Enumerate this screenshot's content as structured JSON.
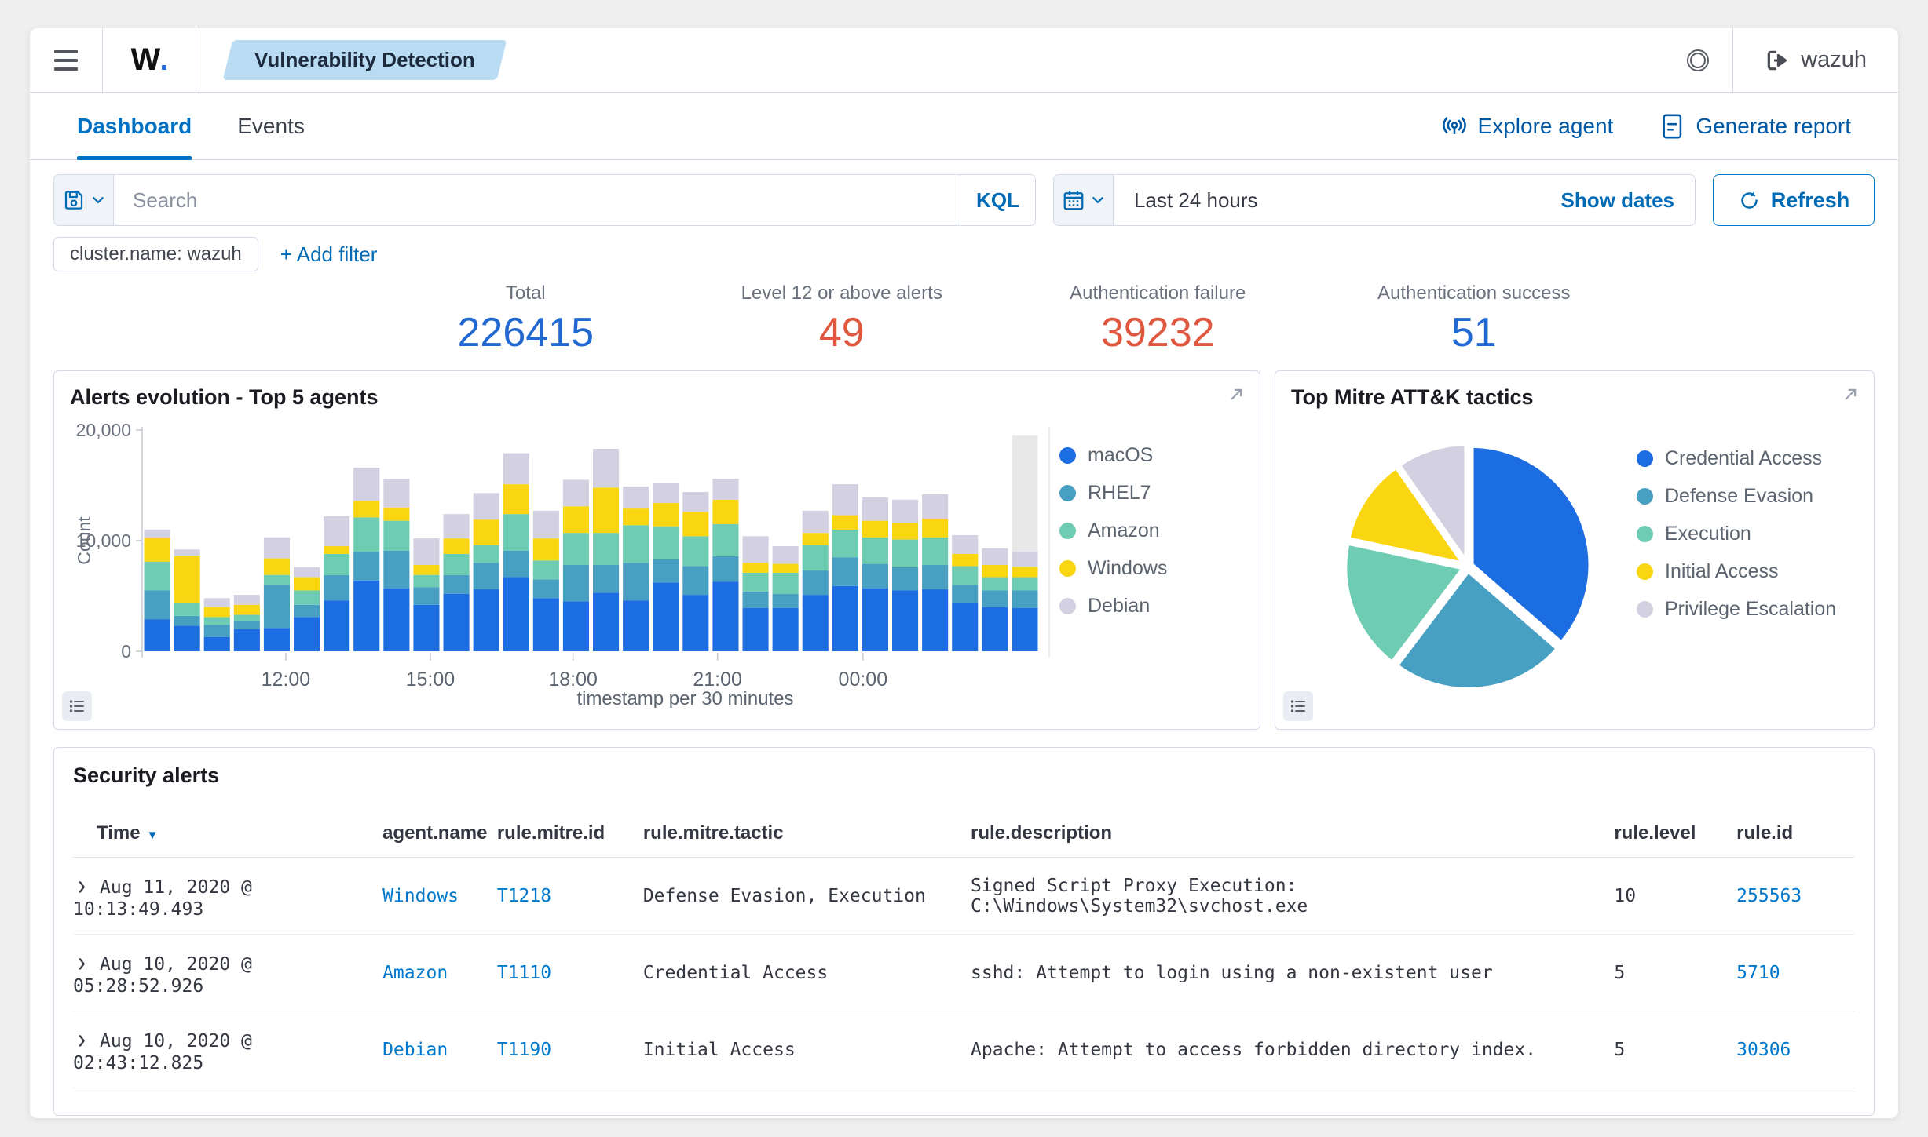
{
  "header": {
    "logo_text": "W",
    "logo_dot": ".",
    "breadcrumb": "Vulnerability Detection",
    "user": "wazuh"
  },
  "tabs": {
    "items": [
      {
        "label": "Dashboard"
      },
      {
        "label": "Events"
      }
    ],
    "actions": [
      {
        "label": "Explore agent"
      },
      {
        "label": "Generate report"
      }
    ]
  },
  "search": {
    "placeholder": "Search",
    "kql_label": "KQL",
    "date_value": "Last 24 hours",
    "show_dates_label": "Show dates",
    "refresh_label": "Refresh"
  },
  "filters": {
    "chip": "cluster.name: wazuh",
    "add_label": "+ Add filter"
  },
  "stats": {
    "items": [
      {
        "label": "Total",
        "value": "226415",
        "color": "#2268d1"
      },
      {
        "label": "Level 12 or above alerts",
        "value": "49",
        "color": "#e0573f"
      },
      {
        "label": "Authentication failure",
        "value": "39232",
        "color": "#e0573f"
      },
      {
        "label": "Authentication success",
        "value": "51",
        "color": "#2268d1"
      }
    ]
  },
  "chart_data": [
    {
      "type": "bar",
      "stacked": true,
      "title": "Alerts evolution - Top 5 agents",
      "xlabel": "timestamp per 30 minutes",
      "ylabel": "Count",
      "ylim": [
        0,
        20000
      ],
      "yticks": [
        0,
        10000,
        20000
      ],
      "ytick_labels": [
        "0",
        "10,000",
        "20,000"
      ],
      "xticks": [
        {
          "label": "12:00",
          "pos": 0.16
        },
        {
          "label": "15:00",
          "pos": 0.321
        },
        {
          "label": "18:00",
          "pos": 0.48
        },
        {
          "label": "21:00",
          "pos": 0.641
        },
        {
          "label": "00:00",
          "pos": 0.803
        }
      ],
      "legend_position": "right",
      "series": [
        {
          "name": "macOS",
          "color": "#1c6ce2",
          "values": [
            2900,
            2300,
            1300,
            2000,
            2100,
            3100,
            4600,
            6400,
            5700,
            4200,
            5200,
            5600,
            6700,
            4800,
            4500,
            5300,
            4600,
            6200,
            5100,
            6300,
            3900,
            3900,
            5100,
            5900,
            5700,
            5500,
            5600,
            4400,
            4000,
            3900
          ]
        },
        {
          "name": "RHEL7",
          "color": "#479fc2",
          "values": [
            2600,
            900,
            1100,
            700,
            3900,
            1100,
            2300,
            2600,
            3400,
            1600,
            1700,
            2400,
            2400,
            1700,
            3300,
            2500,
            3400,
            2100,
            2600,
            2300,
            1500,
            1300,
            2200,
            2600,
            2200,
            2100,
            2200,
            1600,
            1500,
            1600
          ]
        },
        {
          "name": "Amazon",
          "color": "#6dccb1",
          "values": [
            2600,
            1200,
            700,
            600,
            900,
            1300,
            1900,
            3100,
            2700,
            1100,
            1900,
            1600,
            3300,
            1700,
            2900,
            2900,
            3400,
            3000,
            2700,
            2900,
            1700,
            1900,
            2300,
            2500,
            2400,
            2500,
            2500,
            1700,
            1200,
            1200
          ]
        },
        {
          "name": "Windows",
          "color": "#f9d512",
          "values": [
            2200,
            4200,
            900,
            900,
            1500,
            1200,
            700,
            1500,
            1200,
            900,
            1400,
            2300,
            2700,
            2000,
            2400,
            4100,
            1500,
            2100,
            2200,
            2200,
            900,
            800,
            1100,
            1300,
            1500,
            1500,
            1700,
            1100,
            1100,
            900
          ]
        },
        {
          "name": "Debian",
          "color": "#d3d0e2",
          "values": [
            700,
            600,
            800,
            900,
            1900,
            900,
            2700,
            3000,
            2600,
            2400,
            2200,
            2400,
            2800,
            2500,
            2400,
            3500,
            2000,
            1800,
            1800,
            1900,
            2400,
            1600,
            2000,
            2800,
            2100,
            2100,
            2200,
            1700,
            1500,
            1400
          ]
        }
      ],
      "current_bucket": {
        "index": 29,
        "total": 19500,
        "color": "#e8e8e8"
      },
      "axis_color": "#c6cad1",
      "tick_text_color": "#69707d"
    },
    {
      "type": "pie",
      "title": "Top Mitre ATT&K tactics",
      "labels": [
        "Credential Access",
        "Defense Evasion",
        "Execution",
        "Initial Access",
        "Privilege Escalation"
      ],
      "values": [
        36.4,
        23.9,
        18.1,
        11.9,
        9.7
      ],
      "colors": [
        "#1c6ce2",
        "#479fc2",
        "#6dccb1",
        "#f9d512",
        "#d3d0e2"
      ],
      "legend_position": "right",
      "clockwise": true,
      "start_angle_deg": 0
    }
  ],
  "panels": {
    "alerts_evolution_title": "Alerts evolution - Top 5 agents",
    "mitre_title": "Top Mitre ATT&K tactics",
    "security_alerts_title": "Security alerts"
  },
  "table": {
    "sort_arrow": "▼",
    "row_expander": "›",
    "columns": {
      "time": "Time",
      "agent": "agent.name",
      "mitre_id": "rule.mitre.id",
      "tactic": "rule.mitre.tactic",
      "description": "rule.description",
      "level": "rule.level",
      "rule_id": "rule.id"
    },
    "rows": [
      {
        "time": "Aug 11, 2020 @ 10:13:49.493",
        "agent": "Windows",
        "mitre_id": "T1218",
        "tactic": "Defense Evasion, Execution",
        "description": "Signed Script Proxy Execution: C:\\Windows\\System32\\svchost.exe",
        "level": "10",
        "rule_id": "255563"
      },
      {
        "time": "Aug 10, 2020 @ 05:28:52.926",
        "agent": "Amazon",
        "mitre_id": "T1110",
        "tactic": "Credential Access",
        "description": "sshd: Attempt to login using a non-existent user",
        "level": "5",
        "rule_id": "5710"
      },
      {
        "time": "Aug 10, 2020 @ 02:43:12.825",
        "agent": "Debian",
        "mitre_id": "T1190",
        "tactic": "Initial Access",
        "description": "Apache: Attempt to access forbidden directory index.",
        "level": "5",
        "rule_id": "30306"
      }
    ]
  }
}
